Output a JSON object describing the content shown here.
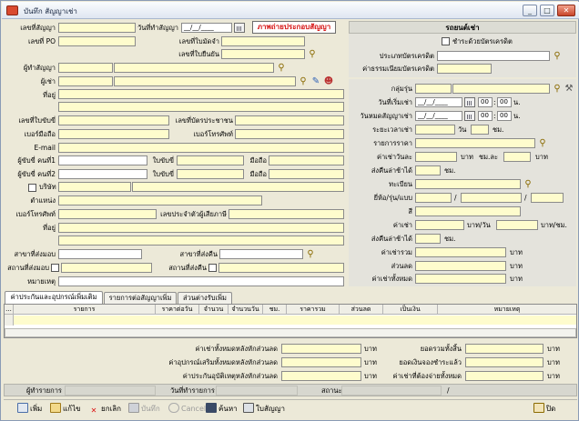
{
  "window": {
    "title": "บันทึก สัญญาเช่า",
    "min": "_",
    "max": "□",
    "close": "✕"
  },
  "colors": {
    "field": "#fefccd",
    "panel": "#e4e3dc",
    "red": "#d50e0e"
  },
  "contract": {
    "contract_no_label": "เลขที่สัญญา",
    "contract_date_label": "วันที่ทำสัญญา",
    "contract_date_value": "__/__/____",
    "po_label": "เลขที่ PO",
    "deposit_no_label": "เลขที่ใบมัดจำ",
    "receipt_no_label": "เลขที่ใบยืนยัน",
    "collateral_button": "ภาพถ่ายประกอบสัญญา"
  },
  "customer": {
    "customer_code_label": "ผู้ทำสัญญา",
    "lessee_label": "ผู้เช่า",
    "address_label": "ที่อยู่",
    "id_card_label": "เลขที่บัตรประชาชน",
    "license_label": "เลขที่ใบขับขี่",
    "mobile_label": "เบอร์มือถือ",
    "phone_label": "เบอร์โทรศัพท์",
    "email_label": "E-mail",
    "driver1_label": "ผู้ขับขี่ คนที่1",
    "driver2_label": "ผู้ขับขี่ คนที่2",
    "license_short": "ใบขับขี่",
    "mobile_short": "มือถือ",
    "company_label": "บริษัท",
    "position_label": "ตำแหน่ง",
    "tel_label": "เบอร์โทรศัพท์",
    "tax_id_label": "เลขประจำตัวผู้เสียภาษี",
    "address2_label": "ที่อยู่",
    "branch_deliver_label": "สาขาที่ส่งมอบ",
    "branch_return_label": "สาขาที่ส่งคืน",
    "place_deliver_label": "สถานที่ส่งมอบ",
    "place_return_label": "สถานที่ส่งคืน",
    "note_label": "หมายเหตุ"
  },
  "car": {
    "header": "รถยนต์เช่า",
    "credit_card_check": "ชำระด้วยบัตรเครดิต",
    "card_type_label": "ประเภทบัตรเครดิต",
    "card_fee_label": "ค่าธรรมเนียมบัตรเครดิต"
  },
  "rental": {
    "group_label": "กลุ่มรุ่น",
    "start_label": "วันที่เริ่มเช่า",
    "end_label": "วันหมดสัญญาเช่า",
    "date_value": "__/__/____",
    "hour_value": "00",
    "min_value": "00",
    "time_unit": "น.",
    "period_label": "ระยะเวลาเช่า",
    "day_unit": "วัน",
    "hour_unit": "ชม.",
    "rate_label": "รายการราคา",
    "daily_label": "ค่าเช่าวันละ",
    "baht": "บาท",
    "extra_hour_label": "ชม.ละ",
    "deposit_label": "ส่งคืนล่าช้าได้",
    "plate_label": "ทะเบียน",
    "brand_label": "ยี่ห้อ/รุ่น/แบบ",
    "slash": "/",
    "color_label": "สี",
    "rent_label": "ค่าเช่า",
    "per_day": "บาท/วัน",
    "per_hour": "บาท/ชม.",
    "late_label": "ส่งคืนล่าช้าได้",
    "total_label": "ค่าเช่ารวม",
    "discount_label": "ส่วนลด",
    "net_label": "ค่าเช่าทั้งหมด"
  },
  "tabs": [
    {
      "label": "ค่าประกันและอุปกรณ์เพิ่มเติม"
    },
    {
      "label": "รายการต่อสัญญาเพิ่ม"
    },
    {
      "label": "ส่วนต่างรับเพิ่ม"
    }
  ],
  "grid_columns": [
    "...",
    "รายการ",
    "ราคาต่อวัน",
    "จำนวน",
    "จำนวนวัน",
    "ชม.",
    "ราคารวม",
    "ส่วนลด",
    "เป็นเงิน",
    "หมายเหตุ"
  ],
  "summary": {
    "rent_after_discount": "ค่าเช่าทั้งหมดหลังหักส่วนลด",
    "equip_after_discount": "ค่าอุปกรณ์เสริมทั้งหมดหลังหักส่วนลด",
    "insurance_after_discount": "ค่าประกันอุบัติเหตุหลังหักส่วนลด",
    "grand_total": "ยอดรวมทั้งสิ้น",
    "paid": "ยอดเงินจองชำระแล้ว",
    "remaining": "ค่าเช่าที่ต้องจ่ายทั้งหมด",
    "baht": "บาท"
  },
  "status": {
    "recorder_label": "ผู้ทำรายการ",
    "record_date_label": "วันที่ทำรายการ",
    "state_label": "สถานะ",
    "slash": "/"
  },
  "toolbar": {
    "add": "เพิ่ม",
    "edit": "แก้ไข",
    "cancel_doc": "ยกเลิก",
    "save": "บันทึก",
    "cancel": "Cancel",
    "search": "ค้นหา",
    "print": "ใบสัญญา",
    "close": "ปิด"
  }
}
